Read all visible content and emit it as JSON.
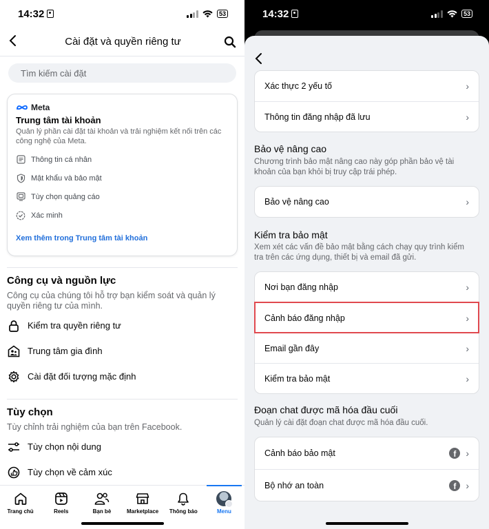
{
  "status": {
    "time": "14:32",
    "battery": "53"
  },
  "left": {
    "header": {
      "title": "Cài đặt và quyền riêng tư"
    },
    "search": {
      "placeholder": "Tìm kiếm cài đặt"
    },
    "meta_card": {
      "brand": "Meta",
      "title": "Trung tâm tài khoản",
      "description": "Quản lý phần cài đặt tài khoản và trải nghiệm kết nối trên các công nghệ của Meta.",
      "items": [
        {
          "label": "Thông tin cá nhân",
          "icon": "id-card-icon"
        },
        {
          "label": "Mật khẩu và bảo mật",
          "icon": "shield-icon"
        },
        {
          "label": "Tùy chọn quảng cáo",
          "icon": "monitor-icon"
        },
        {
          "label": "Xác minh",
          "icon": "verified-badge-icon"
        }
      ],
      "link": "Xem thêm trong Trung tâm tài khoản"
    },
    "tools": {
      "title": "Công cụ và nguồn lực",
      "description": "Công cụ của chúng tôi hỗ trợ bạn kiểm soát và quản lý quyền riêng tư của mình.",
      "items": [
        {
          "label": "Kiểm tra quyền riêng tư",
          "icon": "lock-icon"
        },
        {
          "label": "Trung tâm gia đình",
          "icon": "family-icon"
        },
        {
          "label": "Cài đặt đối tượng mặc định",
          "icon": "gear-icon"
        }
      ]
    },
    "preferences": {
      "title": "Tùy chọn",
      "description": "Tùy chỉnh trải nghiệm của bạn trên Facebook.",
      "items": [
        {
          "label": "Tùy chọn nội dung",
          "icon": "sliders-icon"
        },
        {
          "label": "Tùy chọn về cảm xúc",
          "icon": "reaction-icon"
        }
      ]
    },
    "tabbar": [
      {
        "label": "Trang chủ",
        "icon": "home-icon"
      },
      {
        "label": "Reels",
        "icon": "reels-icon"
      },
      {
        "label": "Bạn bè",
        "icon": "friends-icon"
      },
      {
        "label": "Marketplace",
        "icon": "marketplace-icon"
      },
      {
        "label": "Thông báo",
        "icon": "bell-icon"
      },
      {
        "label": "Menu",
        "icon": "avatar"
      }
    ]
  },
  "right": {
    "card_top": [
      {
        "label": "Xác thực 2 yếu tố"
      },
      {
        "label": "Thông tin đăng nhập đã lưu"
      }
    ],
    "advanced": {
      "title": "Bảo vệ nâng cao",
      "description": "Chương trình bảo mật nâng cao này góp phần bảo vệ tài khoản của bạn khỏi bị truy cập trái phép.",
      "items": [
        {
          "label": "Bảo vệ nâng cao"
        }
      ]
    },
    "security_check": {
      "title": "Kiểm tra bảo mật",
      "description": "Xem xét các vấn đề bảo mật bằng cách chạy quy trình kiểm tra trên các ứng dụng, thiết bị và email đã gửi.",
      "items": [
        {
          "label": "Nơi bạn đăng nhập"
        },
        {
          "label": "Cảnh báo đăng nhập"
        },
        {
          "label": "Email gần đây"
        },
        {
          "label": "Kiểm tra bảo mật"
        }
      ]
    },
    "e2ee": {
      "title": "Đoạn chat được mã hóa đầu cuối",
      "description": "Quản lý cài đặt đoạn chat được mã hóa đầu cuối.",
      "items": [
        {
          "label": "Cảnh báo bảo mật"
        },
        {
          "label": "Bộ nhớ an toàn"
        }
      ]
    }
  },
  "colors": {
    "accent": "#1877f2",
    "link": "#216fdb",
    "highlight": "#e0484e"
  }
}
